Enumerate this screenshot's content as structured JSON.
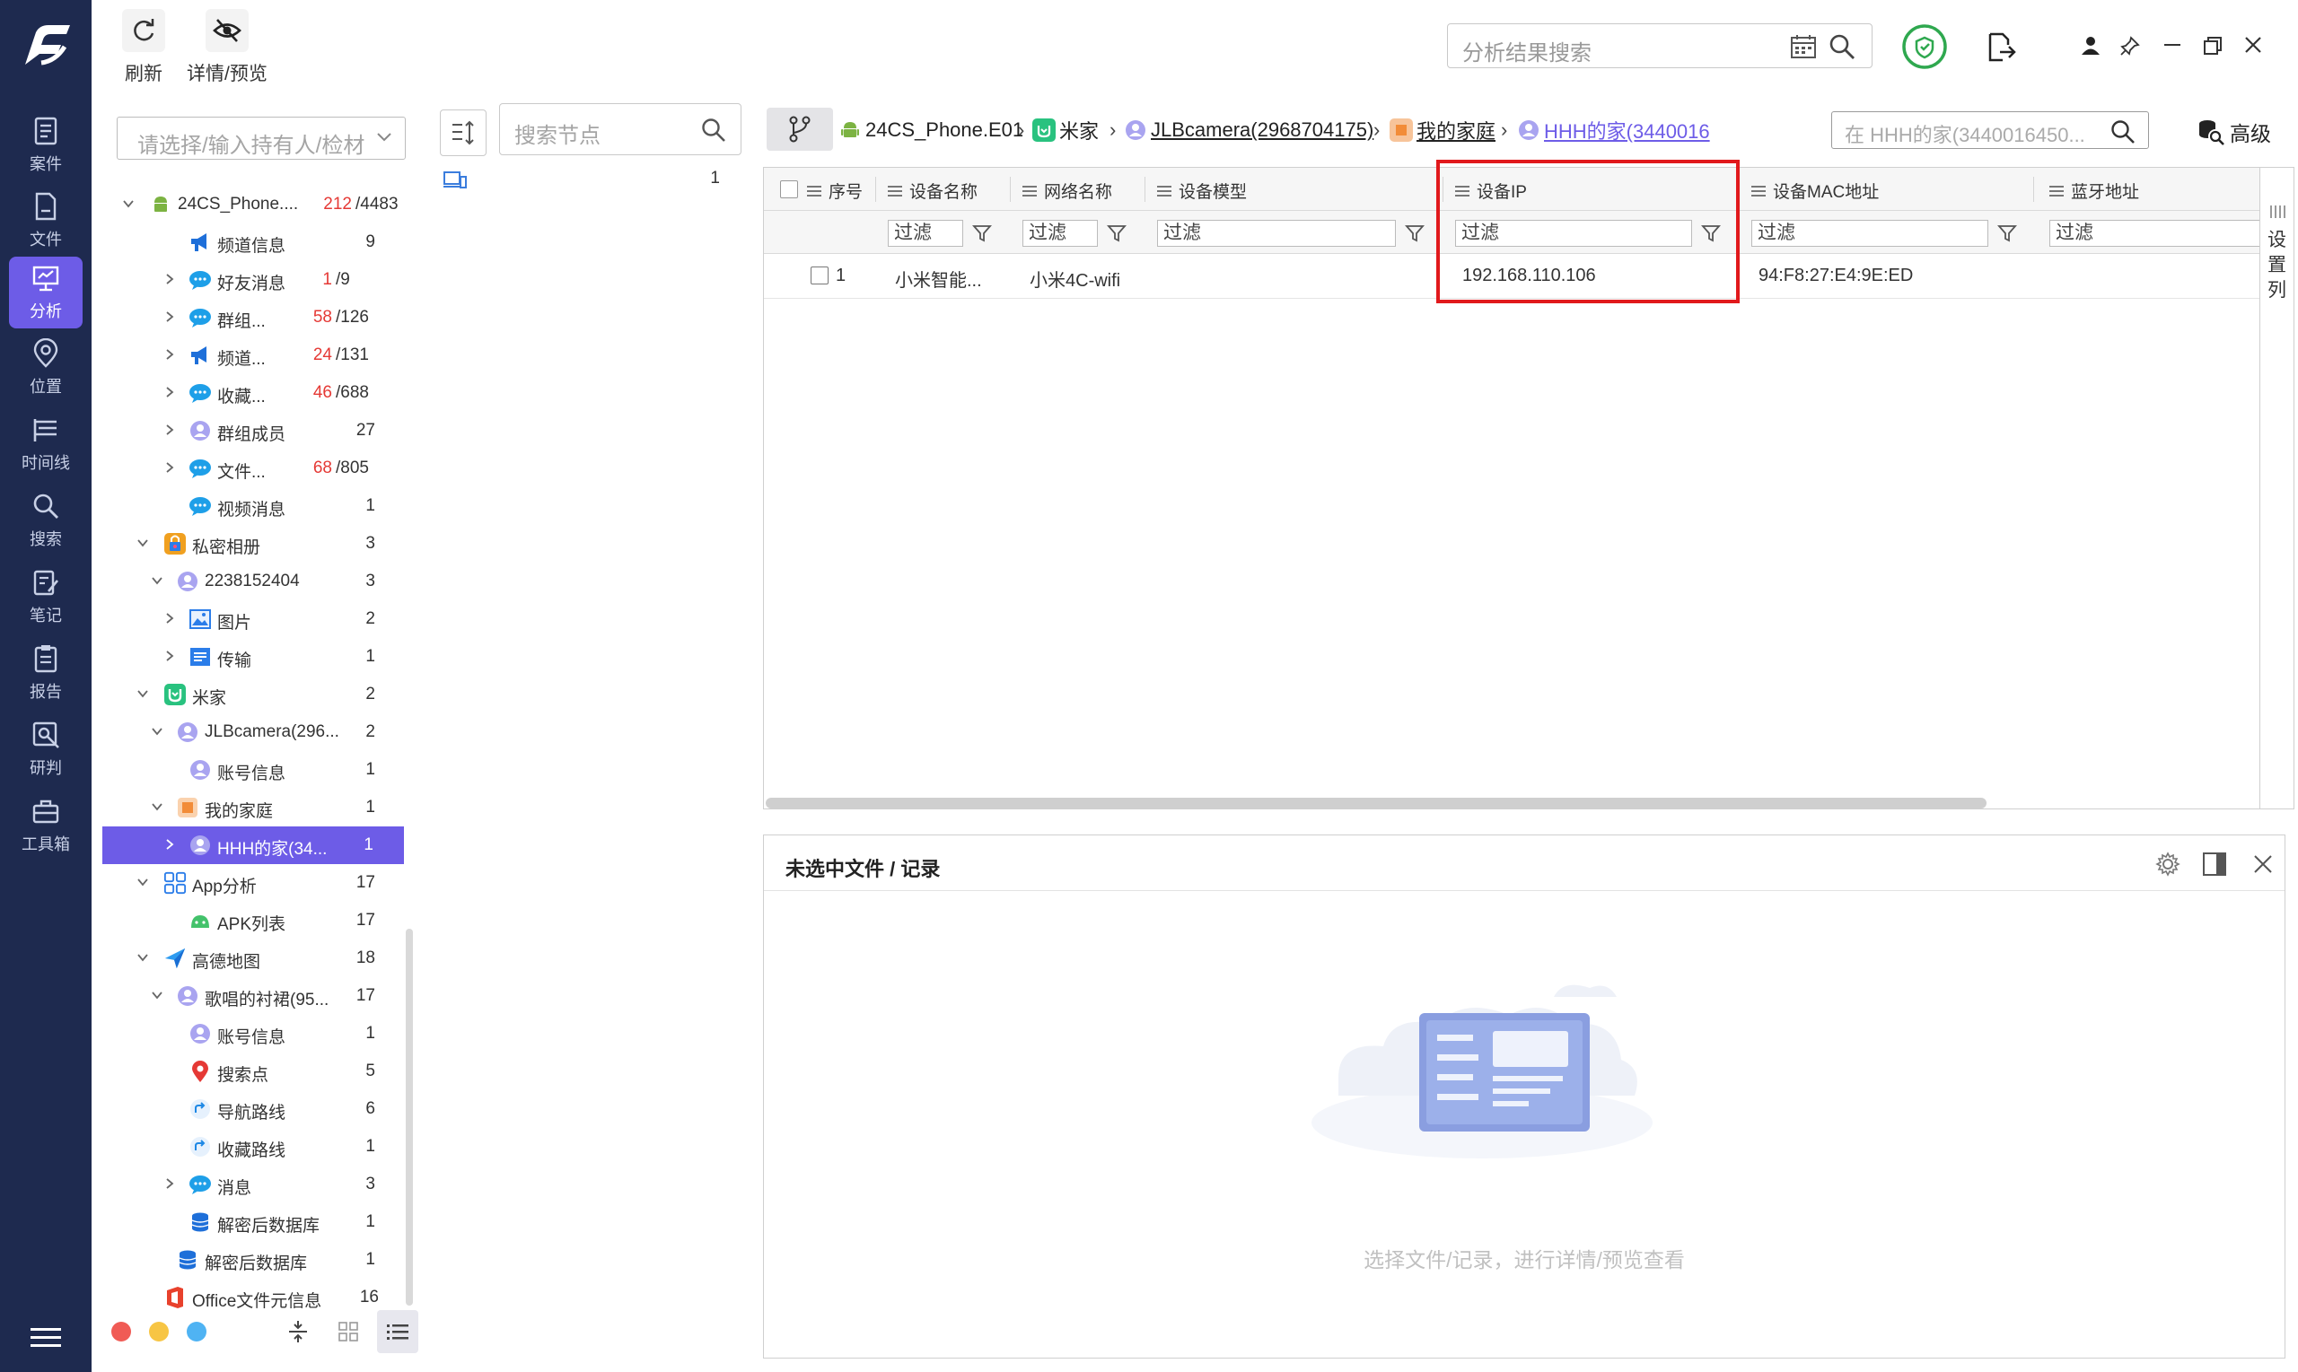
{
  "nav": {
    "items": [
      {
        "label": "案件",
        "icon": "document-icon"
      },
      {
        "label": "文件",
        "icon": "file-icon"
      },
      {
        "label": "分析",
        "icon": "monitor-icon",
        "active": true
      },
      {
        "label": "位置",
        "icon": "location-icon"
      },
      {
        "label": "时间线",
        "icon": "timeline-icon"
      },
      {
        "label": "搜索",
        "icon": "search-icon"
      },
      {
        "label": "笔记",
        "icon": "note-icon"
      },
      {
        "label": "报告",
        "icon": "report-icon"
      },
      {
        "label": "研判",
        "icon": "analyze-icon"
      },
      {
        "label": "工具箱",
        "icon": "toolbox-icon"
      }
    ]
  },
  "toolbar": {
    "refresh_label": "刷新",
    "detail_label": "详情/预览",
    "search_placeholder": "分析结果搜索"
  },
  "tree_panel": {
    "select_placeholder": "请选择/输入持有人/检材",
    "rows": [
      {
        "label": "24CS_Phone....",
        "red": "212",
        "total": "/4483"
      },
      {
        "label": "频道信息",
        "count": "9"
      },
      {
        "label": "好友消息",
        "red": "1",
        "total": "/9"
      },
      {
        "label": "群组...",
        "red": "58",
        "total": "/126"
      },
      {
        "label": "频道...",
        "red": "24",
        "total": "/131"
      },
      {
        "label": "收藏...",
        "red": "46",
        "total": "/688"
      },
      {
        "label": "群组成员",
        "count": "27"
      },
      {
        "label": "文件...",
        "red": "68",
        "total": "/805"
      },
      {
        "label": "视频消息",
        "count": "1"
      },
      {
        "label": "私密相册",
        "count": "3"
      },
      {
        "label": "2238152404",
        "count": "3"
      },
      {
        "label": "图片",
        "count": "2"
      },
      {
        "label": "传输",
        "count": "1"
      },
      {
        "label": "米家",
        "count": "2"
      },
      {
        "label": "JLBcamera(296...",
        "count": "2"
      },
      {
        "label": "账号信息",
        "count": "1"
      },
      {
        "label": "我的家庭",
        "count": "1"
      },
      {
        "label": "HHH的家(34...",
        "count": "1"
      },
      {
        "label": "App分析",
        "count": "17"
      },
      {
        "label": "APK列表",
        "count": "17"
      },
      {
        "label": "高德地图",
        "count": "18"
      },
      {
        "label": "歌唱的衬裙(95...",
        "count": "17"
      },
      {
        "label": "账号信息",
        "count": "1"
      },
      {
        "label": "搜索点",
        "count": "5"
      },
      {
        "label": "导航路线",
        "count": "6"
      },
      {
        "label": "收藏路线",
        "count": "1"
      },
      {
        "label": "消息",
        "count": "3"
      },
      {
        "label": "解密后数据库",
        "count": "1"
      },
      {
        "label": "解密后数据库",
        "count": "1"
      },
      {
        "label": "Office文件元信息",
        "count": "16"
      }
    ]
  },
  "middle_panel": {
    "search_placeholder": "搜索节点",
    "row_count": "1"
  },
  "breadcrumb": {
    "items": [
      "24CS_Phone.E01",
      "米家",
      "JLBcamera(2968704175)",
      "我的家庭",
      "HHH的家(3440016"
    ],
    "sub_search_placeholder": "在 HHH的家(3440016450...",
    "advanced_label": "高级"
  },
  "grid": {
    "columns": [
      "序号",
      "设备名称",
      "网络名称",
      "设备模型",
      "设备IP",
      "设备MAC地址",
      "蓝牙地址"
    ],
    "filter_placeholder": "过滤",
    "rows": [
      {
        "index": "1",
        "device_name": "小米智能...",
        "network": "小米4C-wifi",
        "model": "",
        "ip": "192.168.110.106",
        "mac": "94:F8:27:E4:9E:ED",
        "bluetooth": ""
      }
    ],
    "side_tab": [
      "设",
      "置",
      "列"
    ]
  },
  "detail_pane": {
    "title": "未选中文件 / 记录",
    "empty_message": "选择文件/记录，进行详情/预览查看"
  },
  "colors": {
    "nav_bg": "#1e2a4f",
    "accent": "#6d5ce7",
    "highlight_box": "#e1191c",
    "red_count": "#e53935"
  }
}
